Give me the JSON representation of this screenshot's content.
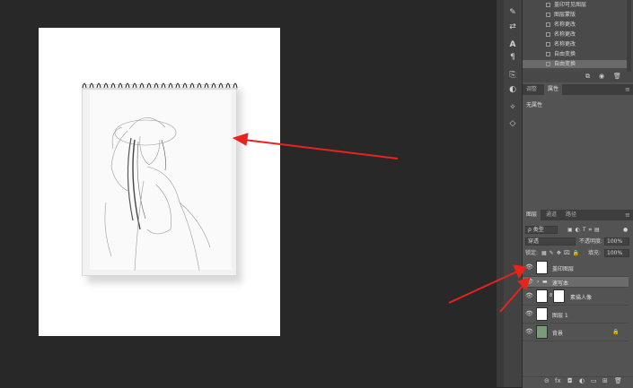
{
  "history": {
    "items": [
      "盖印可见图层",
      "图层蒙版",
      "名称更改",
      "名称更改",
      "名称更改",
      "自由变换",
      "自由变换"
    ],
    "selected_index": 6
  },
  "properties": {
    "tabs": [
      "调整",
      "属性"
    ],
    "active_tab": "属性",
    "empty_text": "无属性"
  },
  "layers_panel": {
    "tabs": [
      "图层",
      "通道",
      "路径"
    ],
    "active_tab": "图层",
    "filter_label": "ρ 类型",
    "blend_mode": "穿透",
    "opacity_label": "不透明度:",
    "opacity_value": "100%",
    "lock_label": "锁定:",
    "fill_label": "填充:",
    "fill_value": "100%",
    "layers": [
      {
        "name": "盖印图层",
        "visible": true,
        "active": false,
        "type": "pixel"
      },
      {
        "name": "速写本",
        "visible": true,
        "active": true,
        "type": "group"
      },
      {
        "name": "素描人像",
        "visible": true,
        "active": false,
        "type": "masked"
      },
      {
        "name": "图层 1",
        "visible": true,
        "active": false,
        "type": "pixel"
      },
      {
        "name": "背景",
        "visible": true,
        "active": false,
        "type": "background"
      }
    ]
  },
  "icons": {
    "eye": "eye-icon",
    "folder": "folder-icon",
    "lock": "lock-icon",
    "chain": "link-icon"
  },
  "colors": {
    "canvas_bg": "#282828",
    "panel_bg": "#535353",
    "arrow": "#e8231e",
    "active_layer": "#6b6b6b"
  }
}
